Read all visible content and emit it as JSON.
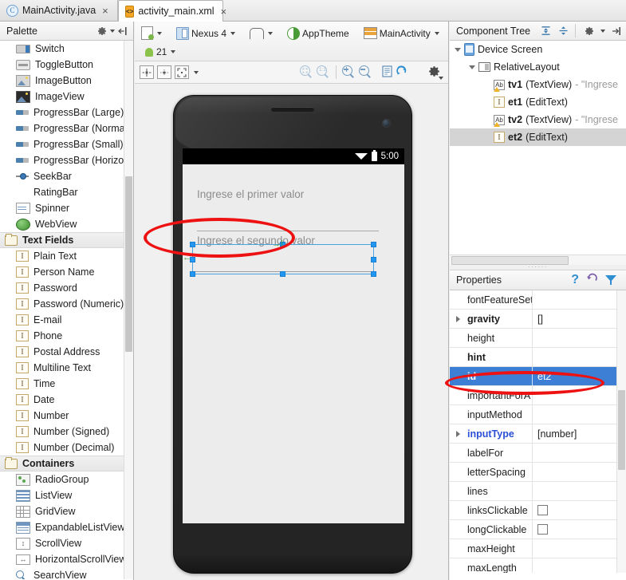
{
  "window": {
    "tabs": [
      {
        "label": "MainActivity.java",
        "icon": "java-class-icon",
        "active": false,
        "close": "×"
      },
      {
        "label": "activity_main.xml",
        "icon": "xml-layout-icon",
        "active": true,
        "close": "×"
      }
    ]
  },
  "palette": {
    "title": "Palette",
    "gear_icon": "gear-icon",
    "collapse_icon": "collapse-panel-icon",
    "items": [
      {
        "label": "Switch",
        "icon": "switch-icon",
        "type": "widget"
      },
      {
        "label": "ToggleButton",
        "icon": "toggle-button-icon",
        "type": "widget"
      },
      {
        "label": "ImageButton",
        "icon": "image-button-icon",
        "type": "widget"
      },
      {
        "label": "ImageView",
        "icon": "image-view-icon",
        "type": "widget"
      },
      {
        "label": "ProgressBar (Large)",
        "icon": "progress-bar-icon",
        "type": "widget"
      },
      {
        "label": "ProgressBar (Normal)",
        "icon": "progress-bar-icon",
        "type": "widget"
      },
      {
        "label": "ProgressBar (Small)",
        "icon": "progress-bar-icon",
        "type": "widget"
      },
      {
        "label": "ProgressBar (Horizontal)",
        "icon": "progress-bar-icon",
        "type": "widget"
      },
      {
        "label": "SeekBar",
        "icon": "seek-bar-icon",
        "type": "widget"
      },
      {
        "label": "RatingBar",
        "icon": "rating-bar-icon",
        "type": "widget"
      },
      {
        "label": "Spinner",
        "icon": "spinner-icon",
        "type": "widget"
      },
      {
        "label": "WebView",
        "icon": "web-view-icon",
        "type": "widget"
      },
      {
        "label": "Text Fields",
        "icon": "folder-icon",
        "type": "group"
      },
      {
        "label": "Plain Text",
        "icon": "text-field-icon",
        "type": "widget"
      },
      {
        "label": "Person Name",
        "icon": "text-field-icon",
        "type": "widget"
      },
      {
        "label": "Password",
        "icon": "text-field-icon",
        "type": "widget"
      },
      {
        "label": "Password (Numeric)",
        "icon": "text-field-icon",
        "type": "widget"
      },
      {
        "label": "E-mail",
        "icon": "text-field-icon",
        "type": "widget"
      },
      {
        "label": "Phone",
        "icon": "text-field-icon",
        "type": "widget"
      },
      {
        "label": "Postal Address",
        "icon": "text-field-icon",
        "type": "widget"
      },
      {
        "label": "Multiline Text",
        "icon": "text-field-icon",
        "type": "widget"
      },
      {
        "label": "Time",
        "icon": "text-field-icon",
        "type": "widget"
      },
      {
        "label": "Date",
        "icon": "text-field-icon",
        "type": "widget"
      },
      {
        "label": "Number",
        "icon": "text-field-icon",
        "type": "widget"
      },
      {
        "label": "Number (Signed)",
        "icon": "text-field-icon",
        "type": "widget"
      },
      {
        "label": "Number (Decimal)",
        "icon": "text-field-icon",
        "type": "widget"
      },
      {
        "label": "Containers",
        "icon": "folder-icon",
        "type": "group"
      },
      {
        "label": "RadioGroup",
        "icon": "radio-group-icon",
        "type": "widget"
      },
      {
        "label": "ListView",
        "icon": "list-view-icon",
        "type": "widget"
      },
      {
        "label": "GridView",
        "icon": "grid-view-icon",
        "type": "widget"
      },
      {
        "label": "ExpandableListView",
        "icon": "expandable-list-view-icon",
        "type": "widget"
      },
      {
        "label": "ScrollView",
        "icon": "scroll-view-icon",
        "type": "widget"
      },
      {
        "label": "HorizontalScrollView",
        "icon": "horizontal-scroll-view-icon",
        "type": "widget"
      },
      {
        "label": "SearchView",
        "icon": "search-view-icon",
        "type": "widget"
      }
    ]
  },
  "editor_toolbar": {
    "layout_variant": "layout-variant-icon",
    "device": "Nexus 4",
    "orientation_icon": "orientation-icon",
    "theme": "AppTheme",
    "activity": "MainActivity",
    "locale_icon": "locale-globe-icon",
    "api_level": "21",
    "view_buttons": [
      "center-align-icon",
      "distribute-icon",
      "expand-icon"
    ],
    "zoom_fit_icon": "zoom-fit-icon",
    "zoom_actual_icon": "zoom-actual-size-icon",
    "zoom_in_icon": "zoom-in-icon",
    "zoom_out_icon": "zoom-out-icon",
    "render_icon": "render-document-icon",
    "refresh_icon": "refresh-icon",
    "settings_icon": "settings-gear-icon"
  },
  "preview": {
    "status_time": "5:00",
    "wifi_icon": "wifi-icon",
    "battery_icon": "battery-icon",
    "text_first": "Ingrese el primer valor",
    "text_second": "Ingrese el segundo valor",
    "nav_back_icon": "nav-back-icon",
    "nav_home_icon": "nav-home-icon",
    "nav_recents_icon": "nav-recents-icon",
    "selection_color": "#2196f3"
  },
  "component_tree": {
    "title": "Component Tree",
    "expand_icon": "expand-all-icon",
    "collapse_icon": "collapse-all-icon",
    "gear_icon": "gear-icon",
    "hide_icon": "hide-panel-icon",
    "nodes": [
      {
        "label": "Device Screen",
        "icon": "device-screen-icon",
        "indent": 0,
        "twisty": "open",
        "selected": false,
        "type": "",
        "value": ""
      },
      {
        "label": "RelativeLayout",
        "icon": "relative-layout-icon",
        "indent": 1,
        "twisty": "open",
        "selected": false,
        "type": "",
        "value": ""
      },
      {
        "label": "tv1",
        "icon": "textview-icon",
        "indent": 2,
        "twisty": "none",
        "selected": false,
        "type": "(TextView)",
        "value": "- \"Ingrese"
      },
      {
        "label": "et1",
        "icon": "edittext-icon",
        "indent": 2,
        "twisty": "none",
        "selected": false,
        "type": "(EditText)",
        "value": ""
      },
      {
        "label": "tv2",
        "icon": "textview-icon",
        "indent": 2,
        "twisty": "none",
        "selected": false,
        "type": "(TextView)",
        "value": "- \"Ingrese"
      },
      {
        "label": "et2",
        "icon": "edittext-icon",
        "indent": 2,
        "twisty": "none",
        "selected": true,
        "type": "(EditText)",
        "value": ""
      }
    ]
  },
  "properties": {
    "title": "Properties",
    "help_icon": "help-question-icon",
    "restore_icon": "restore-default-icon",
    "filter_icon": "filter-funnel-icon",
    "rows": [
      {
        "name": "fontFeatureSett",
        "value": "",
        "expander": false,
        "bold": false,
        "selected": false,
        "blue": false,
        "checkbox": false
      },
      {
        "name": "gravity",
        "value": "[]",
        "expander": true,
        "bold": true,
        "selected": false,
        "blue": false,
        "checkbox": false
      },
      {
        "name": "height",
        "value": "",
        "expander": false,
        "bold": false,
        "selected": false,
        "blue": false,
        "checkbox": false
      },
      {
        "name": "hint",
        "value": "",
        "expander": false,
        "bold": true,
        "selected": false,
        "blue": false,
        "checkbox": false
      },
      {
        "name": "id",
        "value": "et2",
        "expander": false,
        "bold": true,
        "selected": true,
        "blue": false,
        "checkbox": false
      },
      {
        "name": "importantForA",
        "value": "",
        "expander": false,
        "bold": false,
        "selected": false,
        "blue": false,
        "checkbox": false
      },
      {
        "name": "inputMethod",
        "value": "",
        "expander": false,
        "bold": false,
        "selected": false,
        "blue": false,
        "checkbox": false
      },
      {
        "name": "inputType",
        "value": "[number]",
        "expander": true,
        "bold": true,
        "selected": false,
        "blue": true,
        "checkbox": false
      },
      {
        "name": "labelFor",
        "value": "",
        "expander": false,
        "bold": false,
        "selected": false,
        "blue": false,
        "checkbox": false
      },
      {
        "name": "letterSpacing",
        "value": "",
        "expander": false,
        "bold": false,
        "selected": false,
        "blue": false,
        "checkbox": false
      },
      {
        "name": "lines",
        "value": "",
        "expander": false,
        "bold": false,
        "selected": false,
        "blue": false,
        "checkbox": false
      },
      {
        "name": "linksClickable",
        "value": "",
        "expander": false,
        "bold": false,
        "selected": false,
        "blue": false,
        "checkbox": true
      },
      {
        "name": "longClickable",
        "value": "",
        "expander": false,
        "bold": false,
        "selected": false,
        "blue": false,
        "checkbox": true
      },
      {
        "name": "maxHeight",
        "value": "",
        "expander": false,
        "bold": false,
        "selected": false,
        "blue": false,
        "checkbox": false
      },
      {
        "name": "maxLength",
        "value": "",
        "expander": false,
        "bold": false,
        "selected": false,
        "blue": false,
        "checkbox": false
      }
    ]
  },
  "annotations": {
    "color": "#ee1111",
    "circles": [
      {
        "name": "annotation-circle-preview-selection"
      },
      {
        "name": "annotation-circle-id-property"
      }
    ]
  }
}
